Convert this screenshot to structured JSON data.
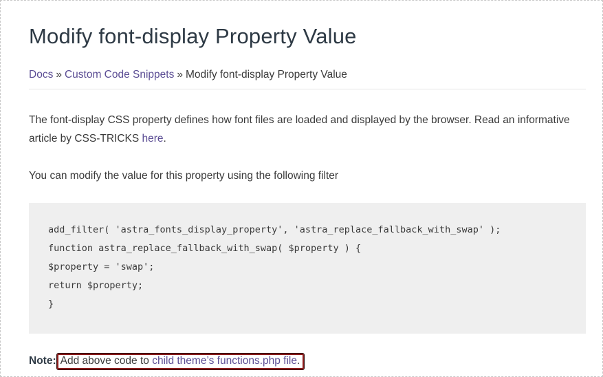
{
  "page": {
    "title": "Modify font-display Property Value"
  },
  "breadcrumb": {
    "items": [
      "Docs",
      "Custom Code Snippets"
    ],
    "separator": "»",
    "current": "Modify font-display Property Value"
  },
  "content": {
    "p1_text": "The font-display CSS property defines how font files are loaded and displayed by the browser. Read an informative article by CSS-TRICKS ",
    "p1_link": "here",
    "p1_end": ".",
    "p2_text": "You can modify the value for this property using the following filter",
    "code_lines": [
      "add_filter( 'astra_fonts_display_property', 'astra_replace_fallback_with_swap' );",
      "function astra_replace_fallback_with_swap( $property ) {",
      "$property = 'swap';",
      "return $property;",
      "}"
    ],
    "note_label": "Note:",
    "note_text": "Add above code to ",
    "note_link": "child theme’s functions.php file",
    "note_end": "."
  },
  "colors": {
    "link": "#5b4d94",
    "highlight_border": "#8b1a1a",
    "code_bg": "#efefef"
  }
}
